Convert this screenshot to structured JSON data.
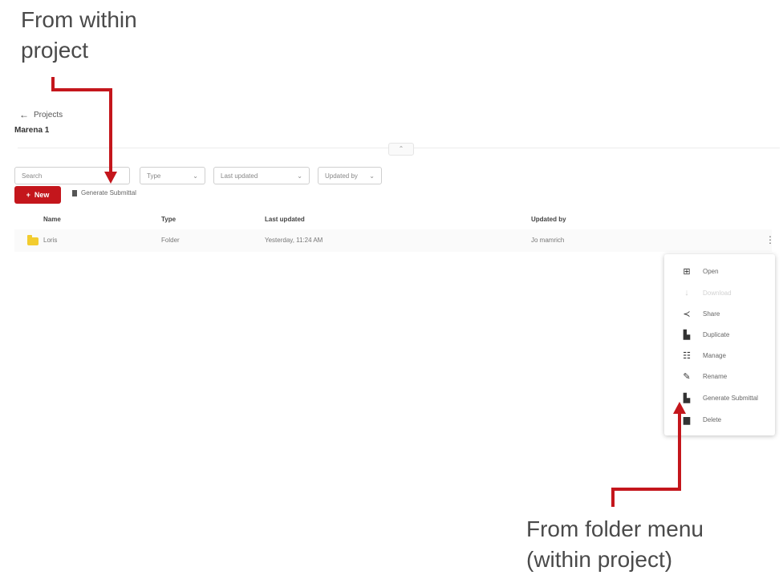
{
  "annotations": {
    "top_line1": "From within",
    "top_line2": "project",
    "bottom_line1": "From folder menu",
    "bottom_line2": "(within project)"
  },
  "header": {
    "back_label": "Projects",
    "project_title": "Marena 1"
  },
  "toolbar": {
    "search_placeholder": "Search",
    "filter_type": "Type",
    "filter_last_updated": "Last updated",
    "filter_updated_by": "Updated by",
    "new_button": "New",
    "generate_link": "Generate Submittal"
  },
  "table": {
    "headers": [
      "Name",
      "Type",
      "Last updated",
      "Updated by"
    ],
    "rows": [
      {
        "name": "Loris",
        "type": "Folder",
        "last_updated": "Yesterday, 11:24 AM",
        "updated_by": "Jo mamrich"
      }
    ]
  },
  "context_menu": {
    "items": [
      {
        "icon": "open-icon",
        "label": "Open",
        "enabled": true
      },
      {
        "icon": "download-icon",
        "label": "Download",
        "enabled": false
      },
      {
        "icon": "share-icon",
        "label": "Share",
        "enabled": true
      },
      {
        "icon": "duplicate-icon",
        "label": "Duplicate",
        "enabled": true
      },
      {
        "icon": "manage-icon",
        "label": "Manage",
        "enabled": true
      },
      {
        "icon": "rename-icon",
        "label": "Rename",
        "enabled": true
      },
      {
        "icon": "generate-icon",
        "label": "Generate Submittal",
        "enabled": true
      },
      {
        "icon": "delete-icon",
        "label": "Delete",
        "enabled": true
      }
    ]
  },
  "colors": {
    "accent": "#c4161c",
    "folder": "#f2cc2f",
    "annotation_arrow": "#c4161c"
  }
}
